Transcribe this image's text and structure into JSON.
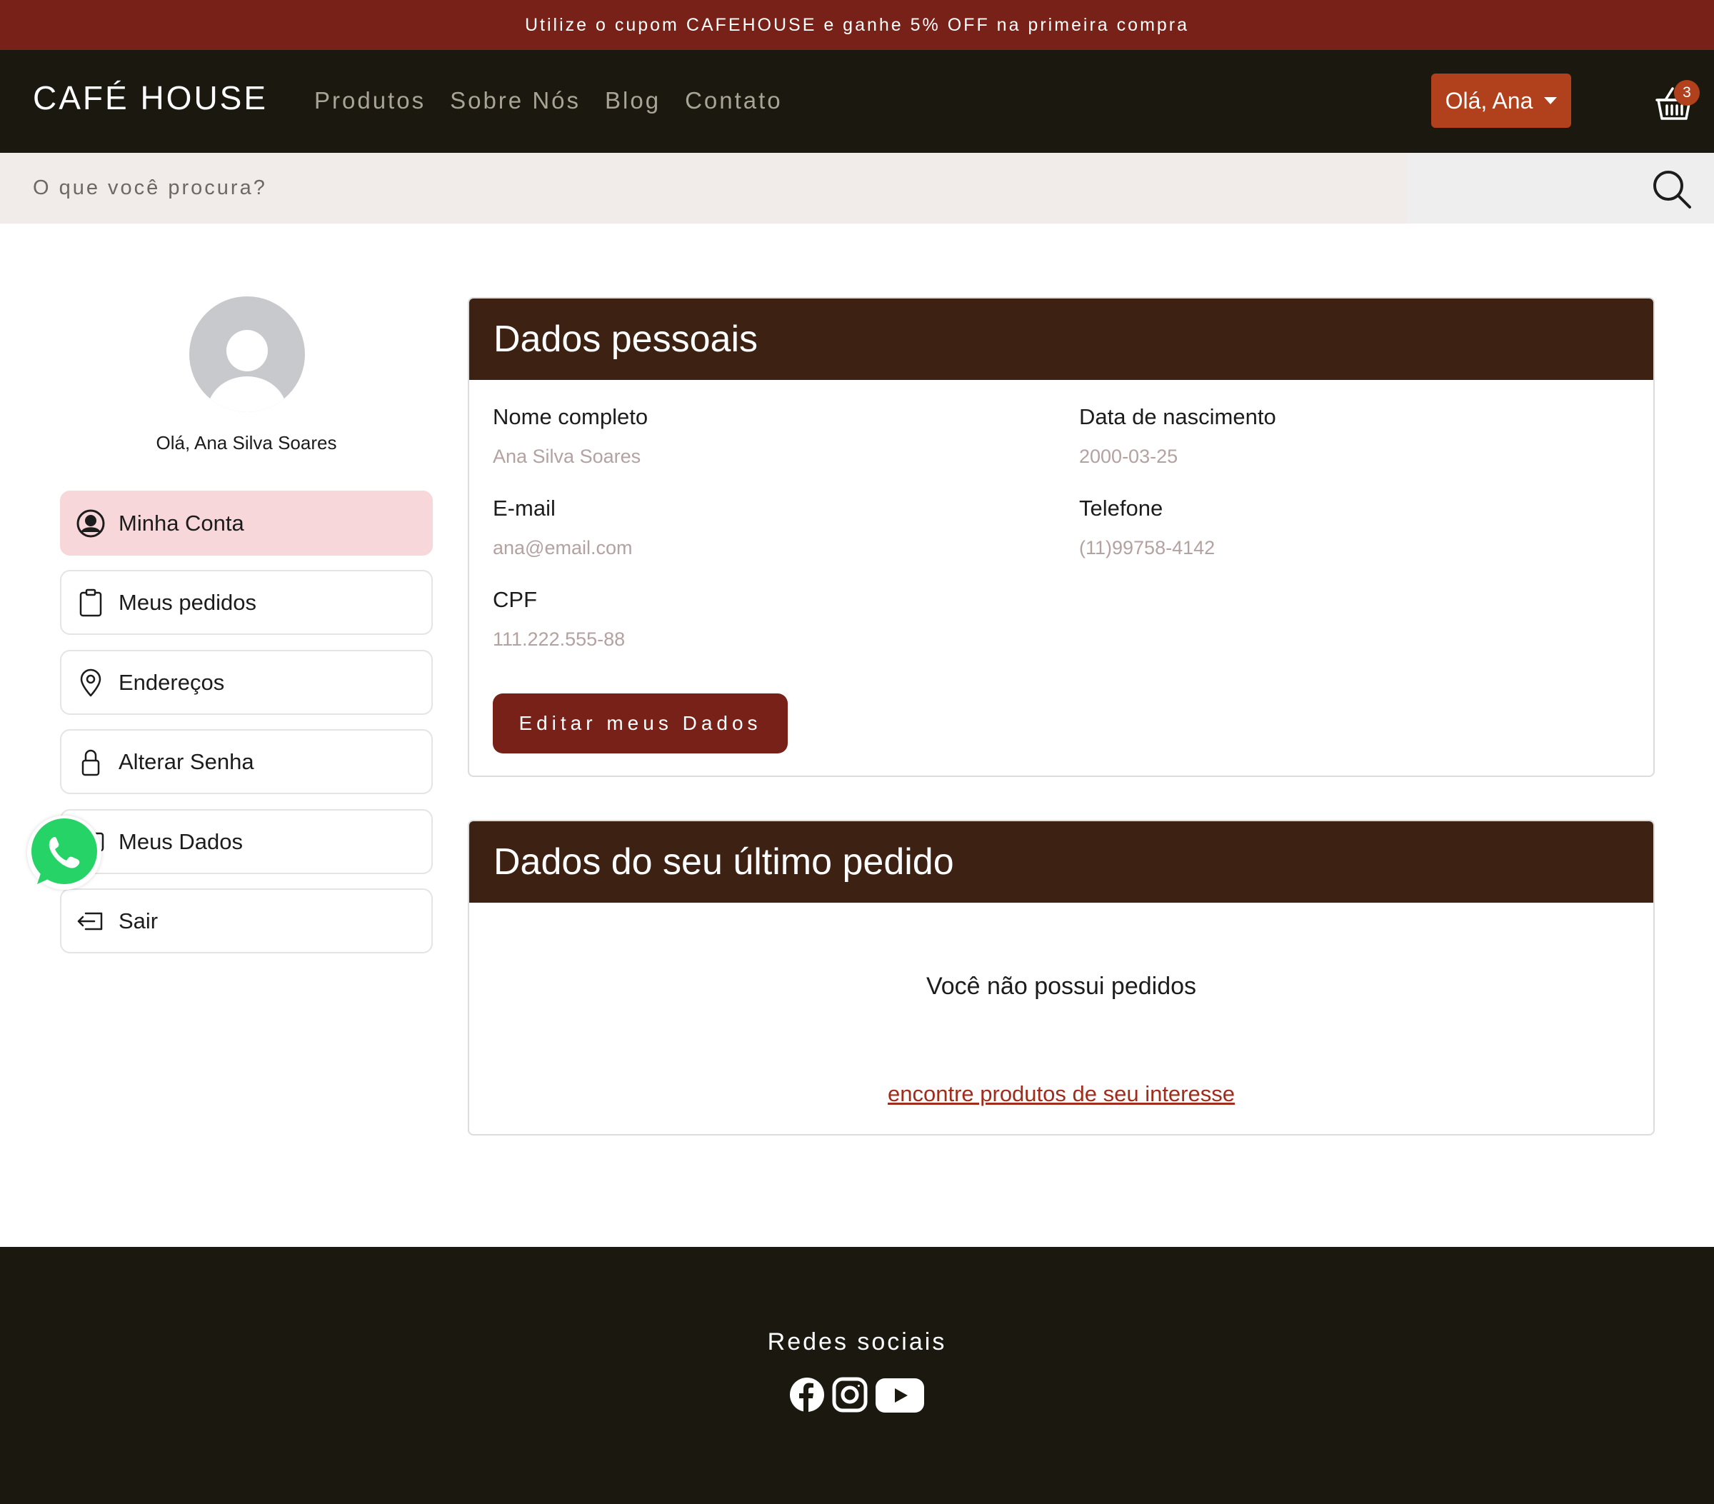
{
  "promo": {
    "text": "Utilize o cupom CAFEHOUSE e ganhe 5% OFF na primeira compra"
  },
  "navbar": {
    "brand": "CAFÉ HOUSE",
    "links": [
      "Produtos",
      "Sobre Nós",
      "Blog",
      "Contato"
    ],
    "user_button": "Olá, Ana",
    "cart_count": "3"
  },
  "search": {
    "placeholder": "O que você procura?"
  },
  "sidebar": {
    "greeting": "Olá, Ana Silva Soares",
    "items": [
      {
        "label": "Minha Conta",
        "icon": "user-circle-icon",
        "active": true
      },
      {
        "label": "Meus pedidos",
        "icon": "clipboard-icon"
      },
      {
        "label": "Endereços",
        "icon": "map-pin-icon"
      },
      {
        "label": "Alterar Senha",
        "icon": "lock-icon"
      },
      {
        "label": "Meus Dados",
        "icon": "id-card-icon"
      },
      {
        "label": "Sair",
        "icon": "logout-icon"
      }
    ]
  },
  "personal": {
    "title": "Dados pessoais",
    "fields": [
      {
        "label": "Nome completo",
        "value": "Ana Silva Soares"
      },
      {
        "label": "Data de nascimento",
        "value": "2000-03-25"
      },
      {
        "label": "E-mail",
        "value": "ana@email.com"
      },
      {
        "label": "Telefone",
        "value": "(11)99758-4142"
      },
      {
        "label": "CPF",
        "value": "111.222.555-88"
      }
    ],
    "edit_button": "Editar meus Dados"
  },
  "last_order": {
    "title": "Dados do seu último pedido",
    "empty_message": "Você não possui pedidos",
    "link_text": "encontre produtos de seu interesse"
  },
  "footer": {
    "title": "Redes sociais",
    "icons": [
      "facebook-icon",
      "instagram-icon",
      "youtube-icon"
    ]
  },
  "colors": {
    "promo_bg": "#772119",
    "navbar_bg": "#1a180f",
    "accent": "#b1401c",
    "card_header_bg": "#3d2214",
    "active_item_bg": "#f8d7da",
    "whatsapp_green": "#25d366"
  }
}
